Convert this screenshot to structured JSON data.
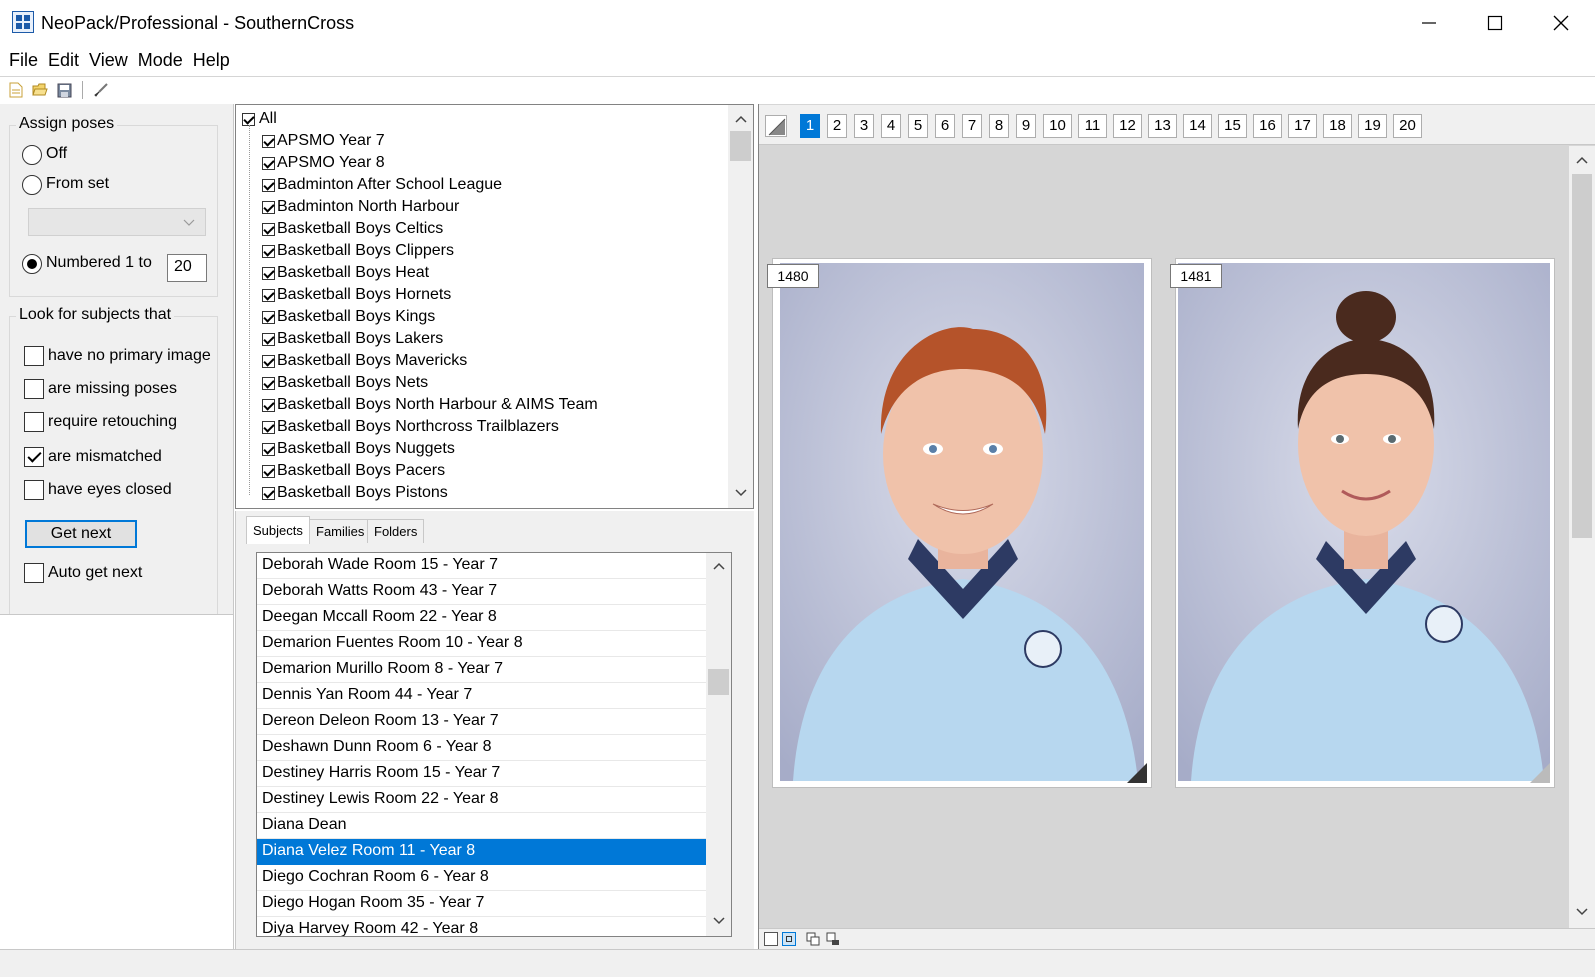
{
  "window": {
    "title": "NeoPack/Professional - SouthernCross",
    "controls": [
      "minimize-icon",
      "maximize-icon",
      "close-icon"
    ]
  },
  "menu": {
    "items": [
      "File",
      "Edit",
      "View",
      "Mode",
      "Help"
    ]
  },
  "toolbar": {
    "icons": [
      "new-file-icon",
      "open-folder-icon",
      "save-icon",
      "brush-icon"
    ]
  },
  "assign_poses": {
    "legend": "Assign poses",
    "off_label": "Off",
    "from_set_label": "From set",
    "numbered_label": "Numbered 1 to",
    "numbered_value": "20",
    "selected": "numbered"
  },
  "look_for": {
    "legend": "Look for subjects that",
    "options": [
      {
        "label": "have no primary image",
        "checked": false
      },
      {
        "label": "are missing poses",
        "checked": false
      },
      {
        "label": "require retouching",
        "checked": false
      },
      {
        "label": "are mismatched",
        "checked": true
      },
      {
        "label": "have eyes closed",
        "checked": false
      }
    ],
    "get_next_label": "Get next",
    "auto_get_next_label": "Auto get next",
    "auto_get_next_checked": false
  },
  "group_tree": {
    "root_label": "All",
    "items": [
      "APSMO Year 7",
      "APSMO Year 8",
      "Badminton After School League",
      "Badminton North Harbour",
      "Basketball Boys Celtics",
      "Basketball Boys Clippers",
      "Basketball Boys Heat",
      "Basketball Boys Hornets",
      "Basketball Boys Kings",
      "Basketball Boys Lakers",
      "Basketball Boys Mavericks",
      "Basketball Boys Nets",
      "Basketball Boys North Harbour & AIMS Team",
      "Basketball Boys Northcross Trailblazers",
      "Basketball Boys Nuggets",
      "Basketball Boys Pacers",
      "Basketball Boys Pistons"
    ]
  },
  "tabs": {
    "items": [
      "Subjects",
      "Families",
      "Folders"
    ],
    "active": "Subjects"
  },
  "subjects": {
    "items": [
      "Deborah Wade Room 15 - Year 7",
      "Deborah Watts Room 43 - Year 7",
      "Deegan Mccall Room 22 - Year 8",
      "Demarion Fuentes Room 10 - Year 8",
      "Demarion Murillo Room 8 - Year 7",
      "Dennis Yan Room 44 - Year 7",
      "Dereon Deleon Room 13 - Year 7",
      "Deshawn Dunn Room 6 - Year 8",
      "Destiney Harris Room 15 - Year 7",
      "Destiney Lewis Room 22 - Year 8",
      "Diana Dean",
      "Diana Velez Room 11 - Year 8",
      "Diego Cochran Room 6 - Year 8",
      "Diego Hogan Room 35 - Year 7",
      "Diya Harvey Room 42 - Year 8"
    ],
    "selected": "Diana Velez Room 11 - Year 8"
  },
  "pages": {
    "numbers": [
      "1",
      "2",
      "3",
      "4",
      "5",
      "6",
      "7",
      "8",
      "9",
      "10",
      "11",
      "12",
      "13",
      "14",
      "15",
      "16",
      "17",
      "18",
      "19",
      "20"
    ],
    "active": "1"
  },
  "photos": [
    {
      "number": "1480",
      "hair_color": "#b5532a",
      "uniform_color": "#b7d7ef",
      "collar_color": "#2d3a63"
    },
    {
      "number": "1481",
      "hair_color": "#4a2a1e",
      "uniform_color": "#b7d7ef",
      "collar_color": "#2d3a63"
    }
  ],
  "colors": {
    "accent": "#0078d7",
    "panel_bg": "#f0f0f0",
    "viewer_bg": "#d6d6d6"
  }
}
